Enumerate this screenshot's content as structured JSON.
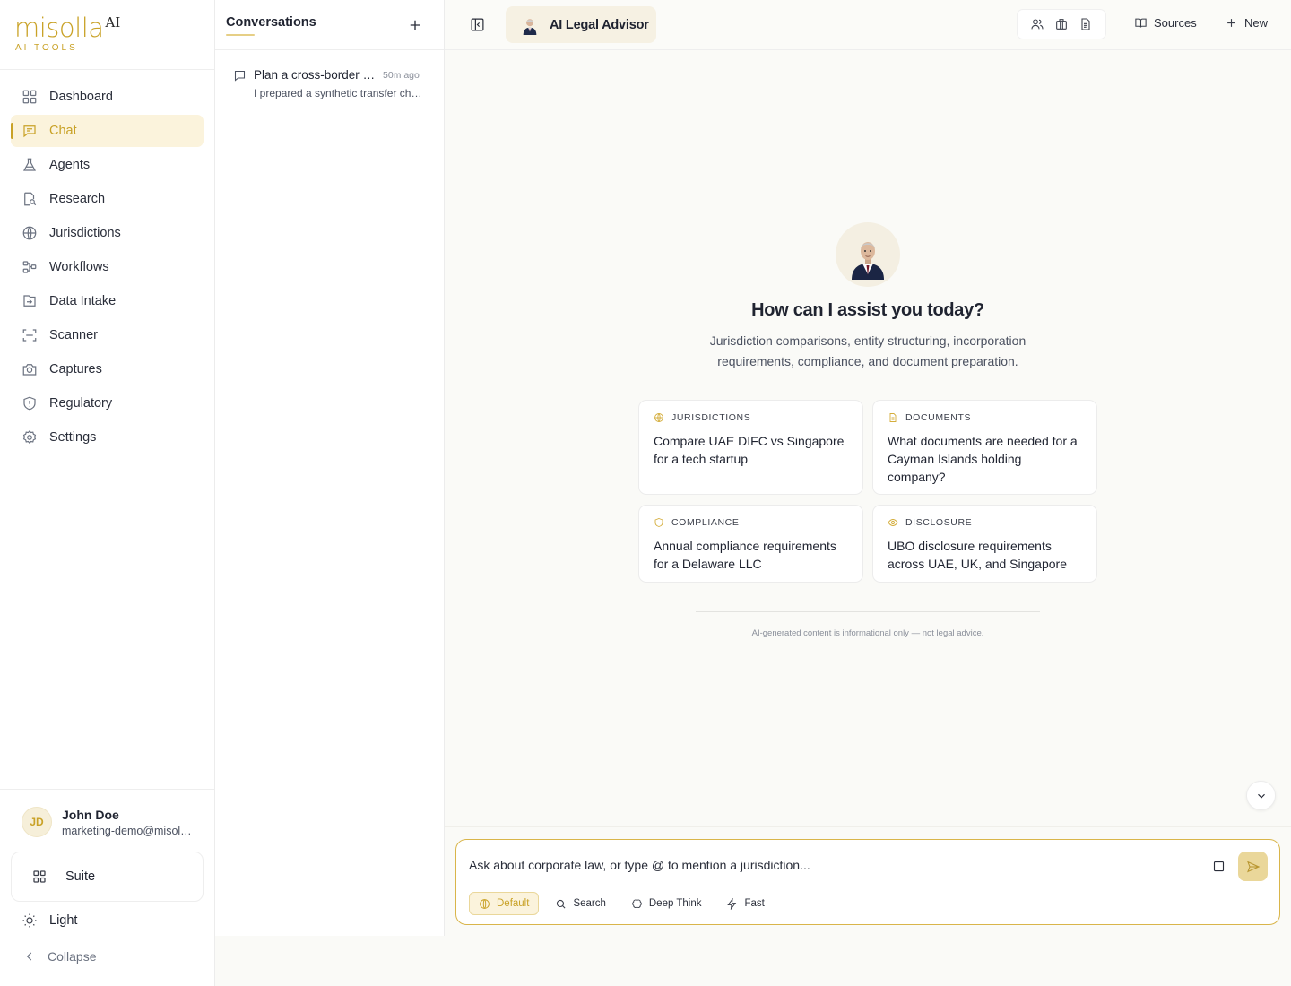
{
  "brand": {
    "logo_text": "misolla",
    "logo_suffix": "AI",
    "logo_tagline": "AI TOOLS",
    "accent_color": "#c9a227"
  },
  "sidebar": {
    "items": [
      {
        "label": "Dashboard",
        "icon": "grid-icon"
      },
      {
        "label": "Chat",
        "icon": "chat-icon",
        "active": true
      },
      {
        "label": "Agents",
        "icon": "flask-icon"
      },
      {
        "label": "Research",
        "icon": "research-icon"
      },
      {
        "label": "Jurisdictions",
        "icon": "globe-icon"
      },
      {
        "label": "Workflows",
        "icon": "workflow-icon"
      },
      {
        "label": "Data Intake",
        "icon": "intake-icon"
      },
      {
        "label": "Scanner",
        "icon": "scan-icon"
      },
      {
        "label": "Captures",
        "icon": "camera-icon"
      },
      {
        "label": "Regulatory",
        "icon": "shield-icon"
      },
      {
        "label": "Settings",
        "icon": "gear-icon"
      }
    ],
    "user": {
      "initials": "JD",
      "name": "John Doe",
      "email": "marketing-demo@misolla.ai"
    },
    "suite_label": "Suite",
    "theme_label": "Light",
    "collapse_label": "Collapse"
  },
  "conversations": {
    "title": "Conversations",
    "items": [
      {
        "title": "Plan a cross-border entity structure",
        "time": "50m ago",
        "preview": "I prepared a synthetic transfer checklist for the structure"
      }
    ]
  },
  "topbar": {
    "agent_name": "AI Legal Advisor",
    "sources_label": "Sources",
    "new_label": "New"
  },
  "hero": {
    "title": "How can I assist you today?",
    "subtitle": "Jurisdiction comparisons, entity structuring, incorporation requirements, compliance, and document preparation."
  },
  "suggestions": [
    {
      "category": "JURISDICTIONS",
      "icon": "globe-icon",
      "text": "Compare UAE DIFC vs Singapore for a tech startup"
    },
    {
      "category": "DOCUMENTS",
      "icon": "document-icon",
      "text": "What documents are needed for a Cayman Islands holding company?"
    },
    {
      "category": "COMPLIANCE",
      "icon": "shield-icon",
      "text": "Annual compliance requirements for a Delaware LLC"
    },
    {
      "category": "DISCLOSURE",
      "icon": "eye-icon",
      "text": "UBO disclosure requirements across UAE, UK, and Singapore"
    }
  ],
  "disclaimer": "AI-generated content is informational only — not legal advice.",
  "composer": {
    "placeholder": "Ask about corporate law, or type @ to mention a jurisdiction...",
    "value": "",
    "modes": [
      {
        "label": "Default",
        "icon": "globe-icon",
        "active": true
      },
      {
        "label": "Search",
        "icon": "search-icon"
      },
      {
        "label": "Deep Think",
        "icon": "brain-icon"
      },
      {
        "label": "Fast",
        "icon": "bolt-icon"
      }
    ]
  }
}
